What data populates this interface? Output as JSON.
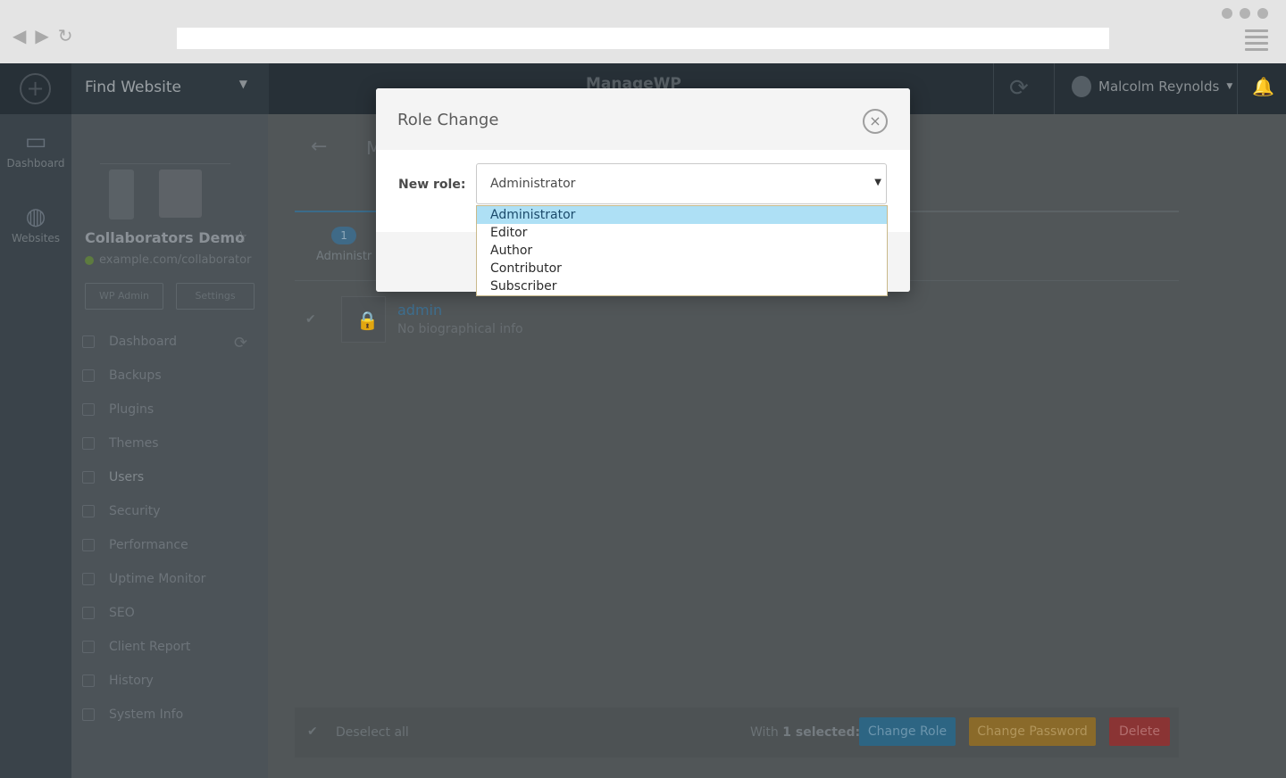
{
  "browser": {
    "back_icon": "back-arrow-icon",
    "forward_icon": "forward-arrow-icon",
    "reload_icon": "reload-icon",
    "url": "",
    "menu_icon": "hamburger-menu-icon"
  },
  "header": {
    "find_website": "Find Website",
    "logo": "ManageWP",
    "user_name": "Malcolm Reynolds"
  },
  "rail": {
    "items": [
      {
        "label": "Dashboard",
        "icon": "dashboard-icon"
      },
      {
        "label": "Websites",
        "icon": "globe-icon"
      }
    ]
  },
  "sidebar": {
    "site_title": "Collaborators Demo",
    "site_url": "example.com/collaborator",
    "wp_admin": "WP Admin",
    "settings": "Settings",
    "menu": [
      "Dashboard",
      "Backups",
      "Plugins",
      "Themes",
      "Users",
      "Security",
      "Performance",
      "Uptime Monitor",
      "SEO",
      "Client Report",
      "History",
      "System Info"
    ],
    "active_item": "Users"
  },
  "main": {
    "page_heading": "M",
    "tab": {
      "count": "1",
      "label": "Administr"
    },
    "user": {
      "name": "admin",
      "bio": "No biographical info"
    },
    "footer": {
      "deselect_all": "Deselect all",
      "with_selected_prefix": "With",
      "selected_count": "1 selected:",
      "change_role": "Change Role",
      "change_password": "Change Password",
      "delete": "Delete"
    }
  },
  "modal": {
    "title": "Role Change",
    "new_role_label": "New role:",
    "selected_role": "Administrator",
    "options": [
      "Administrator",
      "Editor",
      "Author",
      "Contributor",
      "Subscriber"
    ]
  },
  "colors": {
    "change_role_btn": "#2d6583",
    "change_password_btn": "#8a6a2a",
    "delete_btn": "#8a3434",
    "dropdown_highlight": "#aee0f5"
  }
}
